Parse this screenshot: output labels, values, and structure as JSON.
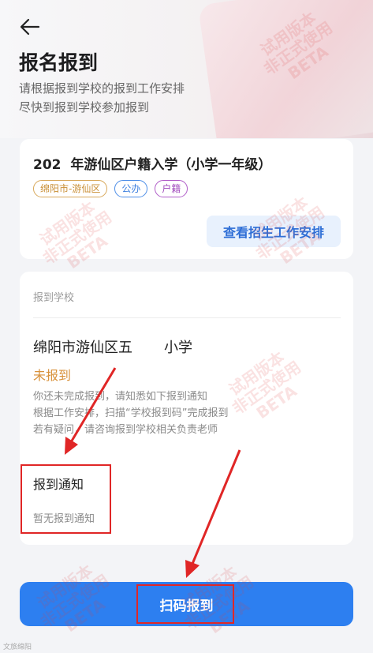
{
  "header": {
    "title": "报名报到",
    "subtitle_lines": [
      "请根据报到学校的报到工作安排",
      "尽快到报到学校参加报到"
    ]
  },
  "program": {
    "title": "202  年游仙区户籍入学（小学一年级）",
    "tags": [
      "绵阳市-游仙区",
      "公办",
      "户籍"
    ],
    "view_button": "查看招生工作安排"
  },
  "school": {
    "section_label": "报到学校",
    "name": "绵阳市游仙区五       小学",
    "status": "未报到",
    "notes": [
      "你还未完成报到，请知悉如下报到通知",
      "根据工作安排，扫描“学校报到码”完成报到",
      "若有疑问，请咨询报到学校相关负责老师"
    ],
    "notice_title": "报到通知",
    "notice_empty": "暂无报到通知"
  },
  "actions": {
    "scan_label": "扫码报到"
  },
  "watermark": {
    "lines": [
      "试用版本",
      "非正式使用",
      "BETA"
    ]
  },
  "brand": {
    "text": "文旅绵阳"
  },
  "colors": {
    "primary": "#2d7ff0",
    "status_orange": "#d8913a",
    "annotation_red": "#e02626",
    "tag_region": "#d8a85a",
    "tag_public": "#4d8ee7",
    "tag_huji": "#b05cc8"
  },
  "icons": {
    "back": "arrow-left-icon"
  }
}
